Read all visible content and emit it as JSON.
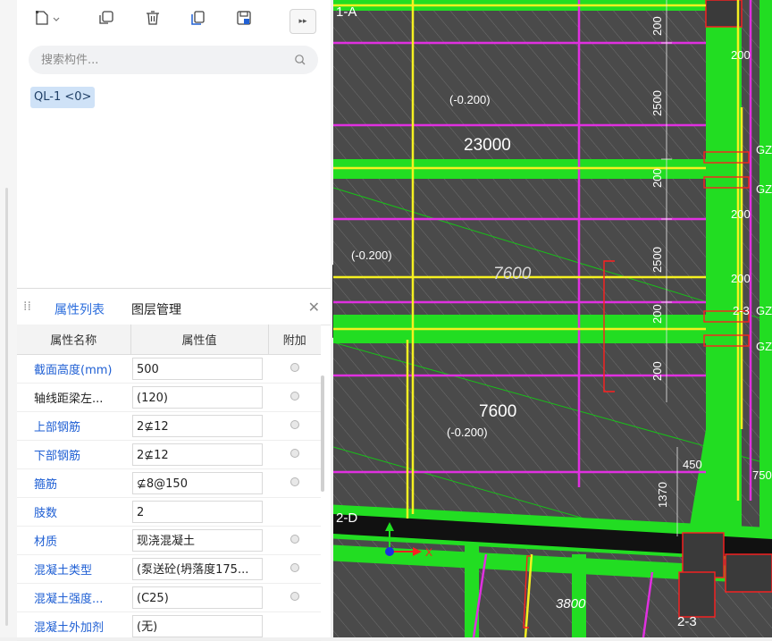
{
  "toolbar": {
    "icons": [
      "new-component-icon",
      "dropdown-arrow-icon",
      "copy-icon",
      "delete-icon",
      "layer-copy-icon",
      "save-to-library-icon"
    ],
    "more_label": "▸▸"
  },
  "search": {
    "placeholder": "搜索构件..."
  },
  "component_list": [
    {
      "label": "QL-1 <0>",
      "selected": true
    }
  ],
  "property_panel": {
    "tabs": [
      "属性列表",
      "图层管理"
    ],
    "active_tab": "属性列表",
    "columns": [
      "属性名称",
      "属性值",
      "附加"
    ],
    "rows": [
      {
        "name": "截面高度(mm)",
        "value": "500",
        "name_color": "blue",
        "has_check": true
      },
      {
        "name": "轴线距梁左...",
        "value": "(120)",
        "name_color": "black",
        "has_check": true
      },
      {
        "name": "上部钢筋",
        "value": "2⊈12",
        "name_color": "blue",
        "has_check": true
      },
      {
        "name": "下部钢筋",
        "value": "2⊈12",
        "name_color": "blue",
        "has_check": true
      },
      {
        "name": "箍筋",
        "value": "⊈8@150",
        "name_color": "blue",
        "has_check": true
      },
      {
        "name": "肢数",
        "value": "2",
        "name_color": "blue",
        "has_check": false
      },
      {
        "name": "材质",
        "value": "现浇混凝土",
        "name_color": "blue",
        "has_check": true
      },
      {
        "name": "混凝土类型",
        "value": "(泵送砼(坍落度175...",
        "name_color": "blue",
        "has_check": true
      },
      {
        "name": "混凝土强度...",
        "value": "(C25)",
        "name_color": "blue",
        "has_check": true
      },
      {
        "name": "混凝土外加剂",
        "value": "(无)",
        "name_color": "blue",
        "has_check": false
      }
    ]
  },
  "canvas": {
    "axis_labels": [
      "1-A",
      "2-D",
      "2-3"
    ],
    "elevation_labels": [
      "(-0.200)",
      "(-0.200)",
      "(-0.200)"
    ],
    "span_labels": [
      "23000",
      "7600",
      "7600",
      "3800"
    ],
    "dim_labels": [
      "200",
      "200",
      "2500",
      "200",
      "200",
      "2500",
      "200",
      "200",
      "200",
      "450",
      "1370",
      "750"
    ],
    "column_tags": [
      "GZ",
      "GZ",
      "GZ",
      "GZ",
      "2-3"
    ],
    "coordinate_x_label": "X",
    "colors": {
      "background": "#4a4a4a",
      "wall_green": "#22dd22",
      "beam_yellow": "#f5f020",
      "rebar_magenta": "#e030e0",
      "red": "#ff2020",
      "white": "#f0f0f0"
    }
  }
}
